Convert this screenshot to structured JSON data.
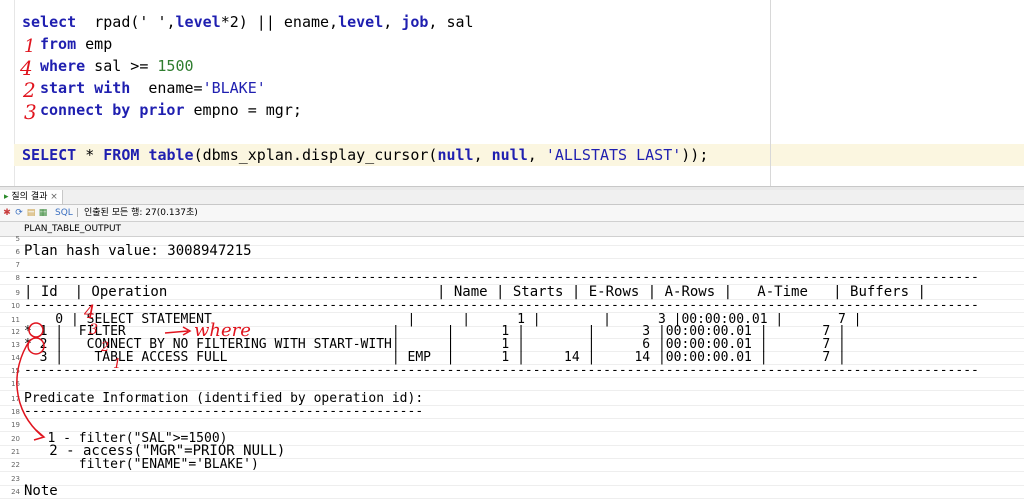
{
  "editor": {
    "line1": {
      "k1": "select",
      "t1": "  rpad(' ',",
      "k2": "level",
      "t2": "*2) || ename,",
      "k3": "level",
      ",": ", ",
      "k4": "job",
      ",2": ", sal"
    },
    "line2": {
      "k": "from",
      "t": " emp"
    },
    "line3": {
      "k": "where",
      "t": " sal >= ",
      "n": "1500"
    },
    "line4": {
      "k": "start with",
      "t": "  ename=",
      "s": "'BLAKE'"
    },
    "line5": {
      "k": "connect by prior",
      "t": " empno = mgr;"
    },
    "line6": {
      "k1": "SELECT",
      "t1": " * ",
      "k2": "FROM",
      "t2": " ",
      "k3": "table",
      "t3": "(dbms_xplan.display_cursor(",
      "k4": "null",
      ",1": ", ",
      "k5": "null",
      ",2": ", ",
      "s": "'ALLSTATS LAST'",
      "t4": "));"
    }
  },
  "tab": {
    "label": "질의 결과",
    "close": "×"
  },
  "toolbar": {
    "sql_label": "SQL",
    "status": "인출된 모든 행: 27(0.137초)"
  },
  "column_header": "PLAN_TABLE_OUTPUT",
  "rows": [
    {
      "n": "5",
      "text": ""
    },
    {
      "n": "6",
      "text": "Plan hash value: 3008947215"
    },
    {
      "n": "7",
      "text": ""
    },
    {
      "n": "8",
      "text": "--------------------------------------------------------------------------------------------------------------------------"
    },
    {
      "n": "9",
      "text": "| Id  | Operation                                | Name | Starts | E-Rows | A-Rows |   A-Time   | Buffers |"
    },
    {
      "n": "10",
      "text": "--------------------------------------------------------------------------------------------------------------------------"
    },
    {
      "n": "11",
      "text": "    0 | SELECT STATEMENT                         |      |      1 |        |      3 |00:00:00.01 |       7 |"
    },
    {
      "n": "12",
      "text": "* 1 |  FILTER                                  |      |      1 |        |      3 |00:00:00.01 |       7 |"
    },
    {
      "n": "13",
      "text": "* 2 |   CONNECT BY NO FILTERING WITH START-WITH|      |      1 |        |      6 |00:00:00.01 |       7 |"
    },
    {
      "n": "14",
      "text": "  3 |    TABLE ACCESS FULL                     | EMP  |      1 |     14 |     14 |00:00:00.01 |       7 |"
    },
    {
      "n": "15",
      "text": "--------------------------------------------------------------------------------------------------------------------------"
    },
    {
      "n": "16",
      "text": ""
    },
    {
      "n": "17",
      "text": "Predicate Information (identified by operation id):"
    },
    {
      "n": "18",
      "text": "---------------------------------------------------"
    },
    {
      "n": "19",
      "text": ""
    },
    {
      "n": "20",
      "text": "   1 - filter(\"SAL\">=1500)"
    },
    {
      "n": "21",
      "text": "   2 - access(\"MGR\"=PRIOR NULL)"
    },
    {
      "n": "22",
      "text": "       filter(\"ENAME\"='BLAKE')"
    },
    {
      "n": "23",
      "text": ""
    },
    {
      "n": "24",
      "text": "Note"
    }
  ],
  "annotations": {
    "a1": "1",
    "a4": "4",
    "a2": "2",
    "a3": "3",
    "where": "where"
  },
  "colors": {
    "keyword": "#1f1fb0",
    "number": "#2f7d2f",
    "annotation": "#e0141e",
    "highlight": "#fbf6e0"
  }
}
